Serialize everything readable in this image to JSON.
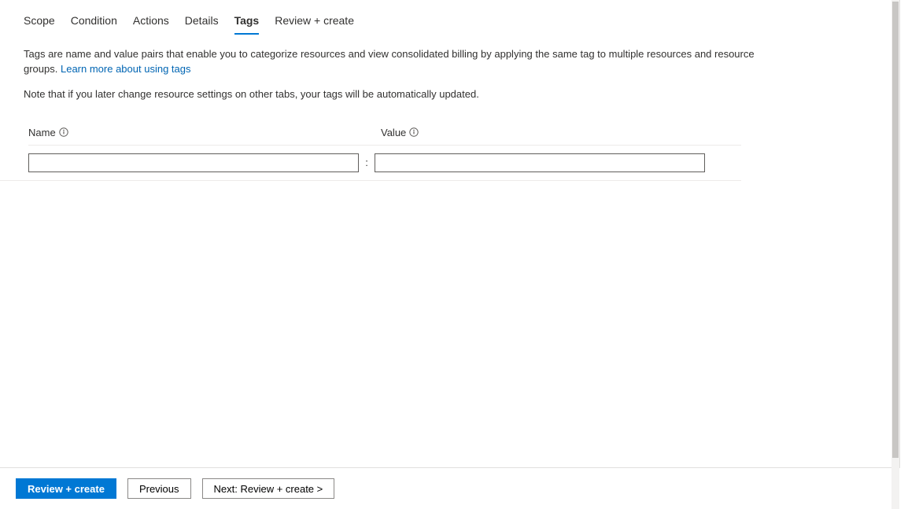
{
  "tabs": {
    "scope": "Scope",
    "condition": "Condition",
    "actions": "Actions",
    "details": "Details",
    "tags": "Tags",
    "review_create": "Review + create"
  },
  "description": {
    "text": "Tags are name and value pairs that enable you to categorize resources and view consolidated billing by applying the same tag to multiple resources and resource groups. ",
    "link": "Learn more about using tags"
  },
  "note": "Note that if you later change resource settings on other tabs, your tags will be automatically updated.",
  "form": {
    "name_label": "Name",
    "value_label": "Value",
    "separator": ":",
    "name_value": "",
    "value_value": ""
  },
  "footer": {
    "review_create": "Review + create",
    "previous": "Previous",
    "next": "Next: Review + create >"
  }
}
